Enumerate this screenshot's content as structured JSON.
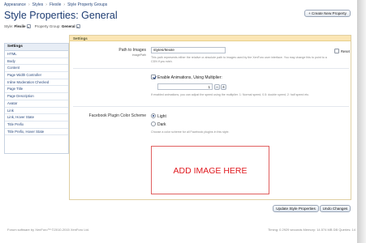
{
  "breadcrumb": [
    "Appearance",
    "Styles",
    "Flexile",
    "Style Property Groups"
  ],
  "breadcrumb_separator": "›",
  "page_title": "Style Properties: General",
  "create_button": "+ Create New Property",
  "style_selector": {
    "style_label": "Style:",
    "style_value": "Flexile",
    "group_label": "Property Group:",
    "group_value": "General"
  },
  "sidebar": {
    "header": "Settings",
    "items": [
      "HTML",
      "Body",
      "Content",
      "Page Width Controller",
      "Inline Moderation Checked",
      "Page Title",
      "Page Description",
      "Avatar",
      "Link",
      "Link, Hover State",
      "Title Prefix",
      "Title Prefix, Hover State"
    ]
  },
  "panel_header": "Settings",
  "path_to_images": {
    "label": "Path to Images",
    "sublabel": "imagePath",
    "value": "styles/flexile",
    "hint": "This path represents either the relative or absolute path to images used by the XenForo user interface. You may change this to point to a CDN if you wish.",
    "reset_label": "Reset"
  },
  "animations": {
    "checkbox_label": "Enable Animations, Using Multiplier:",
    "checked": true,
    "multiplier_value": "1",
    "decrement": "–",
    "increment": "+",
    "hint": "If enabled animations, you can adjust the speed using the multiplier. 1: Normal speed, 0.5: double speed, 2: half speed etc."
  },
  "facebook": {
    "label": "Facebook Plugin Color Scheme",
    "options": [
      {
        "label": "Light",
        "selected": true
      },
      {
        "label": "Dark",
        "selected": false
      }
    ],
    "hint": "Choose a color scheme for all Facebook plugins in this style."
  },
  "image_placeholder": "ADD IMAGE HERE",
  "buttons": {
    "update": "Update Style Properties",
    "undo": "Undo Changes"
  },
  "footer": {
    "left": "Forum software by XenForo™ ©2010-2015 XenForo Ltd.",
    "right": "Timing: 0.2929 seconds Memory: 14.574 MB DB Queries: 14"
  },
  "colors": {
    "title": "#1d3c72",
    "panel_header": "#fbe6b4",
    "placeholder_text": "#e0191f"
  }
}
